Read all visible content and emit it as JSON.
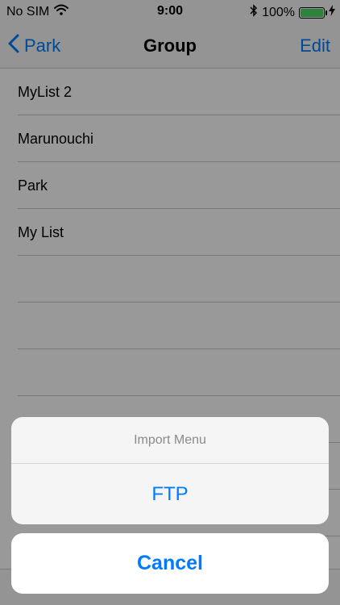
{
  "status_bar": {
    "carrier": "No SIM",
    "time": "9:00",
    "battery_percent": "100%",
    "battery_level": 1.0
  },
  "nav": {
    "back_label": "Park",
    "title": "Group",
    "edit_label": "Edit"
  },
  "list": {
    "items": [
      "MyList 2",
      "Marunouchi",
      "Park",
      "My List",
      "",
      "",
      "",
      "",
      "",
      "",
      ""
    ]
  },
  "action_sheet": {
    "title": "Import Menu",
    "actions": [
      "FTP"
    ],
    "cancel_label": "Cancel"
  },
  "colors": {
    "accent": "#007aff",
    "battery_fill": "#4cd964",
    "separator": "#c8c7cc"
  }
}
